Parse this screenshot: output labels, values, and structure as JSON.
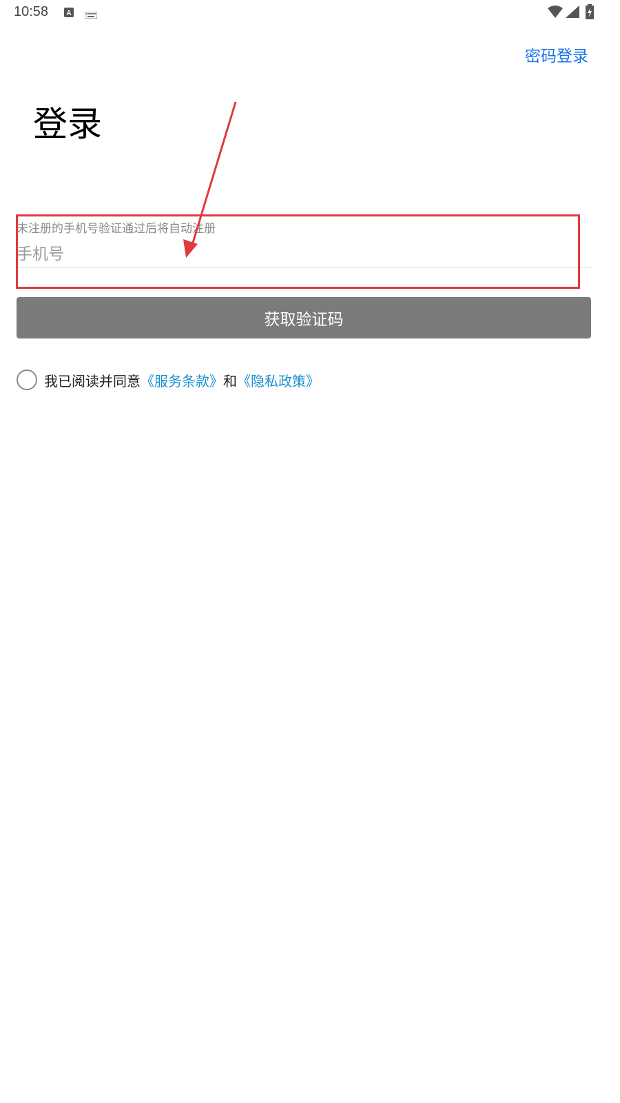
{
  "status_bar": {
    "time": "10:58",
    "icons": [
      "a-notification-icon",
      "keyboard-icon",
      "wifi-icon",
      "signal-icon",
      "battery-charging-icon"
    ]
  },
  "header": {
    "password_login_label": "密码登录"
  },
  "page": {
    "title": "登录"
  },
  "phone_field": {
    "hint": "未注册的手机号验证通过后将自动注册",
    "placeholder": "手机号",
    "value": ""
  },
  "actions": {
    "get_code_label": "获取验证码"
  },
  "agreement": {
    "prefix": "我已阅读并同意",
    "terms_label": "《服务条款》",
    "conjunction": "和",
    "privacy_label": "《隐私政策》",
    "checked": false
  },
  "colors": {
    "link": "#1a73e8",
    "agreement_link": "#1a8fd0",
    "button_bg": "#7b7b7b",
    "annotation": "#e03a3e"
  }
}
